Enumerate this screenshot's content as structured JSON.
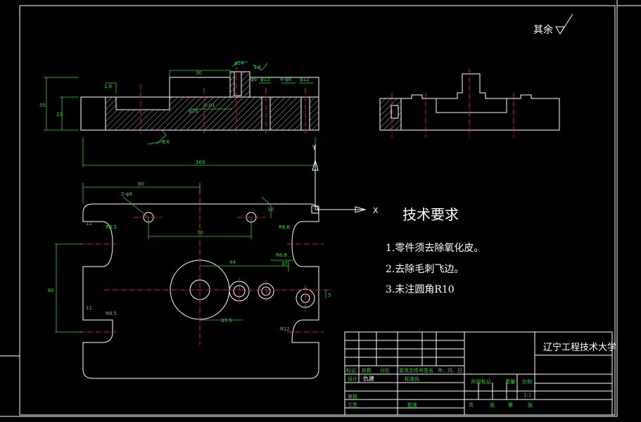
{
  "drawing": {
    "roughness_note": "其余",
    "tech_req": {
      "title": "技术要求",
      "items": [
        "1.零件须去除氧化皮。",
        "2.去除毛刺飞边。",
        "3.未注圆角R10"
      ]
    },
    "ucs": {
      "x_label": "X",
      "y_label": "Y"
    },
    "dims": {
      "d55": "55",
      "d23": "23",
      "d1_6a": "1.6",
      "d30": "30",
      "d14": "φ14",
      "d1_6b": "1.6",
      "d6": "φ6",
      "d12a": "φ12",
      "d4_10": "4-φ8",
      "d12b": "φ12",
      "d16": "φ16",
      "d0_01": "0.01",
      "d1_6c": "1.6",
      "d163": "163",
      "d80": "80",
      "d2_8": "2-φ8",
      "d10": "10",
      "d70": "70",
      "dr8_5a": "R8.5",
      "d11a": "11",
      "dr8_5b": "R8.5",
      "d11b": "11",
      "d44": "44",
      "d37": "37",
      "d37_5": "37.5",
      "d60": "60",
      "d5": "5",
      "dr8_6": "R8.6",
      "dr6_8": "R6.8",
      "dr12": "R12"
    }
  },
  "title_block": {
    "school": "辽宁工程技术大学",
    "headers": [
      "标记",
      "处数",
      "分区",
      "更改文件号",
      "签名",
      "年、月、日"
    ],
    "design_label": "设计",
    "designer": "仇建",
    "standard_label": "标准化",
    "stage_label": "阶段标记",
    "weight_label": "重量",
    "scale_label": "比例",
    "scale_value": "1:1",
    "review_label": "审核",
    "process_label": "工艺",
    "approve_label": "批准",
    "sheets": [
      "共",
      "张",
      "第",
      "张"
    ]
  }
}
